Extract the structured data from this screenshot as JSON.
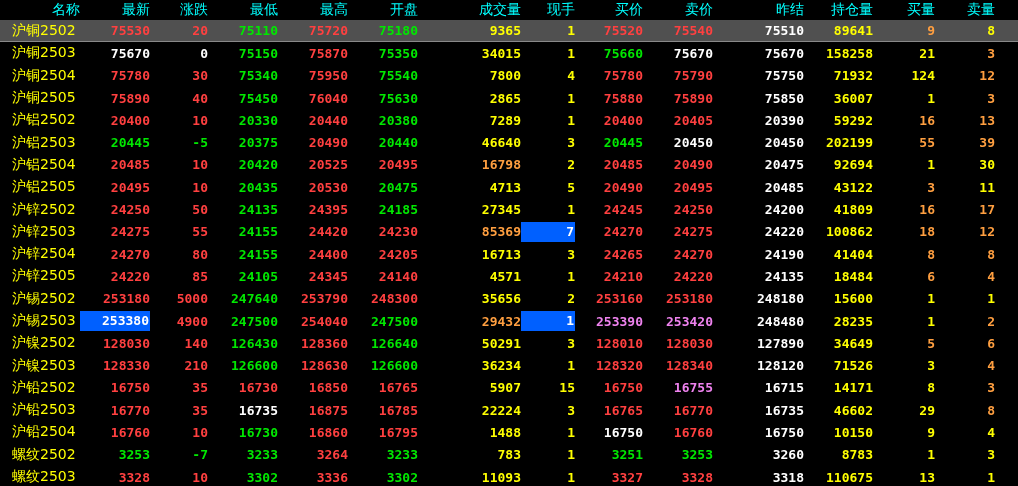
{
  "table": {
    "columns": [
      "名称",
      "最新",
      "涨跌",
      "最低",
      "最高",
      "开盘",
      "成交量",
      "现手",
      "买价",
      "卖价",
      "昨结",
      "持仓量",
      "买量",
      "卖量"
    ],
    "rows": [
      {
        "selected": true,
        "cells": [
          {
            "text": "沪铜2502",
            "color": "#ffff00",
            "highlighted": false
          },
          {
            "text": "75530",
            "color": "#ff4040",
            "highlighted": false
          },
          {
            "text": "20",
            "color": "#ff4040",
            "highlighted": false
          },
          {
            "text": "75110",
            "color": "#00e800",
            "highlighted": false
          },
          {
            "text": "75720",
            "color": "#ff4040",
            "highlighted": false
          },
          {
            "text": "75180",
            "color": "#00e800",
            "highlighted": false
          },
          {
            "text": "9365",
            "color": "#ffff00",
            "highlighted": false
          },
          {
            "text": "1",
            "color": "#ffff00",
            "highlighted": false
          },
          {
            "text": "75520",
            "color": "#ff4040",
            "highlighted": false
          },
          {
            "text": "75540",
            "color": "#ff4040",
            "highlighted": false
          },
          {
            "text": "75510",
            "color": "#ffffff",
            "highlighted": false
          },
          {
            "text": "89641",
            "color": "#ffff00",
            "highlighted": false
          },
          {
            "text": "9",
            "color": "#ff9f40",
            "highlighted": false
          },
          {
            "text": "8",
            "color": "#ffff00",
            "highlighted": false
          }
        ]
      },
      {
        "selected": false,
        "cells": [
          {
            "text": "沪铜2503",
            "color": "#ffff00",
            "highlighted": false
          },
          {
            "text": "75670",
            "color": "#ffffff",
            "highlighted": false
          },
          {
            "text": "0",
            "color": "#ffffff",
            "highlighted": false
          },
          {
            "text": "75150",
            "color": "#00e800",
            "highlighted": false
          },
          {
            "text": "75870",
            "color": "#ff4040",
            "highlighted": false
          },
          {
            "text": "75350",
            "color": "#00e800",
            "highlighted": false
          },
          {
            "text": "34015",
            "color": "#ffff00",
            "highlighted": false
          },
          {
            "text": "1",
            "color": "#ffff00",
            "highlighted": false
          },
          {
            "text": "75660",
            "color": "#00e800",
            "highlighted": false
          },
          {
            "text": "75670",
            "color": "#ffffff",
            "highlighted": false
          },
          {
            "text": "75670",
            "color": "#ffffff",
            "highlighted": false
          },
          {
            "text": "158258",
            "color": "#ffff00",
            "highlighted": false
          },
          {
            "text": "21",
            "color": "#ffff00",
            "highlighted": false
          },
          {
            "text": "3",
            "color": "#ff9f40",
            "highlighted": false
          }
        ]
      },
      {
        "selected": false,
        "cells": [
          {
            "text": "沪铜2504",
            "color": "#ffff00",
            "highlighted": false
          },
          {
            "text": "75780",
            "color": "#ff4040",
            "highlighted": false
          },
          {
            "text": "30",
            "color": "#ff4040",
            "highlighted": false
          },
          {
            "text": "75340",
            "color": "#00e800",
            "highlighted": false
          },
          {
            "text": "75950",
            "color": "#ff4040",
            "highlighted": false
          },
          {
            "text": "75540",
            "color": "#00e800",
            "highlighted": false
          },
          {
            "text": "7800",
            "color": "#ffff00",
            "highlighted": false
          },
          {
            "text": "4",
            "color": "#ffff00",
            "highlighted": false
          },
          {
            "text": "75780",
            "color": "#ff4040",
            "highlighted": false
          },
          {
            "text": "75790",
            "color": "#ff4040",
            "highlighted": false
          },
          {
            "text": "75750",
            "color": "#ffffff",
            "highlighted": false
          },
          {
            "text": "71932",
            "color": "#ffff00",
            "highlighted": false
          },
          {
            "text": "124",
            "color": "#ffff00",
            "highlighted": false
          },
          {
            "text": "12",
            "color": "#ff9f40",
            "highlighted": false
          }
        ]
      },
      {
        "selected": false,
        "cells": [
          {
            "text": "沪铜2505",
            "color": "#ffff00",
            "highlighted": false
          },
          {
            "text": "75890",
            "color": "#ff4040",
            "highlighted": false
          },
          {
            "text": "40",
            "color": "#ff4040",
            "highlighted": false
          },
          {
            "text": "75450",
            "color": "#00e800",
            "highlighted": false
          },
          {
            "text": "76040",
            "color": "#ff4040",
            "highlighted": false
          },
          {
            "text": "75630",
            "color": "#00e800",
            "highlighted": false
          },
          {
            "text": "2865",
            "color": "#ffff00",
            "highlighted": false
          },
          {
            "text": "1",
            "color": "#ffff00",
            "highlighted": false
          },
          {
            "text": "75880",
            "color": "#ff4040",
            "highlighted": false
          },
          {
            "text": "75890",
            "color": "#ff4040",
            "highlighted": false
          },
          {
            "text": "75850",
            "color": "#ffffff",
            "highlighted": false
          },
          {
            "text": "36007",
            "color": "#ffff00",
            "highlighted": false
          },
          {
            "text": "1",
            "color": "#ffff00",
            "highlighted": false
          },
          {
            "text": "3",
            "color": "#ff9f40",
            "highlighted": false
          }
        ]
      },
      {
        "selected": false,
        "cells": [
          {
            "text": "沪铝2502",
            "color": "#ffff00",
            "highlighted": false
          },
          {
            "text": "20400",
            "color": "#ff4040",
            "highlighted": false
          },
          {
            "text": "10",
            "color": "#ff4040",
            "highlighted": false
          },
          {
            "text": "20330",
            "color": "#00e800",
            "highlighted": false
          },
          {
            "text": "20440",
            "color": "#ff4040",
            "highlighted": false
          },
          {
            "text": "20380",
            "color": "#00e800",
            "highlighted": false
          },
          {
            "text": "7289",
            "color": "#ffff00",
            "highlighted": false
          },
          {
            "text": "1",
            "color": "#ffff00",
            "highlighted": false
          },
          {
            "text": "20400",
            "color": "#ff4040",
            "highlighted": false
          },
          {
            "text": "20405",
            "color": "#ff4040",
            "highlighted": false
          },
          {
            "text": "20390",
            "color": "#ffffff",
            "highlighted": false
          },
          {
            "text": "59292",
            "color": "#ffff00",
            "highlighted": false
          },
          {
            "text": "16",
            "color": "#ff9f40",
            "highlighted": false
          },
          {
            "text": "13",
            "color": "#ff9f40",
            "highlighted": false
          }
        ]
      },
      {
        "selected": false,
        "cells": [
          {
            "text": "沪铝2503",
            "color": "#ffff00",
            "highlighted": false
          },
          {
            "text": "20445",
            "color": "#00e800",
            "highlighted": false
          },
          {
            "text": "-5",
            "color": "#00e800",
            "highlighted": false
          },
          {
            "text": "20375",
            "color": "#00e800",
            "highlighted": false
          },
          {
            "text": "20490",
            "color": "#ff4040",
            "highlighted": false
          },
          {
            "text": "20440",
            "color": "#00e800",
            "highlighted": false
          },
          {
            "text": "46640",
            "color": "#ffff00",
            "highlighted": false
          },
          {
            "text": "3",
            "color": "#ffff00",
            "highlighted": false
          },
          {
            "text": "20445",
            "color": "#00e800",
            "highlighted": false
          },
          {
            "text": "20450",
            "color": "#ffffff",
            "highlighted": false
          },
          {
            "text": "20450",
            "color": "#ffffff",
            "highlighted": false
          },
          {
            "text": "202199",
            "color": "#ffff00",
            "highlighted": false
          },
          {
            "text": "55",
            "color": "#ff9f40",
            "highlighted": false
          },
          {
            "text": "39",
            "color": "#ff9f40",
            "highlighted": false
          }
        ]
      },
      {
        "selected": false,
        "cells": [
          {
            "text": "沪铝2504",
            "color": "#ffff00",
            "highlighted": false
          },
          {
            "text": "20485",
            "color": "#ff4040",
            "highlighted": false
          },
          {
            "text": "10",
            "color": "#ff4040",
            "highlighted": false
          },
          {
            "text": "20420",
            "color": "#00e800",
            "highlighted": false
          },
          {
            "text": "20525",
            "color": "#ff4040",
            "highlighted": false
          },
          {
            "text": "20495",
            "color": "#ff4040",
            "highlighted": false
          },
          {
            "text": "16798",
            "color": "#ff9f40",
            "highlighted": false
          },
          {
            "text": "2",
            "color": "#ffff00",
            "highlighted": false
          },
          {
            "text": "20485",
            "color": "#ff4040",
            "highlighted": false
          },
          {
            "text": "20490",
            "color": "#ff4040",
            "highlighted": false
          },
          {
            "text": "20475",
            "color": "#ffffff",
            "highlighted": false
          },
          {
            "text": "92694",
            "color": "#ffff00",
            "highlighted": false
          },
          {
            "text": "1",
            "color": "#ffff00",
            "highlighted": false
          },
          {
            "text": "30",
            "color": "#ffff00",
            "highlighted": false
          }
        ]
      },
      {
        "selected": false,
        "cells": [
          {
            "text": "沪铝2505",
            "color": "#ffff00",
            "highlighted": false
          },
          {
            "text": "20495",
            "color": "#ff4040",
            "highlighted": false
          },
          {
            "text": "10",
            "color": "#ff4040",
            "highlighted": false
          },
          {
            "text": "20435",
            "color": "#00e800",
            "highlighted": false
          },
          {
            "text": "20530",
            "color": "#ff4040",
            "highlighted": false
          },
          {
            "text": "20475",
            "color": "#00e800",
            "highlighted": false
          },
          {
            "text": "4713",
            "color": "#ffff00",
            "highlighted": false
          },
          {
            "text": "5",
            "color": "#ffff00",
            "highlighted": false
          },
          {
            "text": "20490",
            "color": "#ff4040",
            "highlighted": false
          },
          {
            "text": "20495",
            "color": "#ff4040",
            "highlighted": false
          },
          {
            "text": "20485",
            "color": "#ffffff",
            "highlighted": false
          },
          {
            "text": "43122",
            "color": "#ffff00",
            "highlighted": false
          },
          {
            "text": "3",
            "color": "#ff9f40",
            "highlighted": false
          },
          {
            "text": "11",
            "color": "#ffff00",
            "highlighted": false
          }
        ]
      },
      {
        "selected": false,
        "cells": [
          {
            "text": "沪锌2502",
            "color": "#ffff00",
            "highlighted": false
          },
          {
            "text": "24250",
            "color": "#ff4040",
            "highlighted": false
          },
          {
            "text": "50",
            "color": "#ff4040",
            "highlighted": false
          },
          {
            "text": "24135",
            "color": "#00e800",
            "highlighted": false
          },
          {
            "text": "24395",
            "color": "#ff4040",
            "highlighted": false
          },
          {
            "text": "24185",
            "color": "#00e800",
            "highlighted": false
          },
          {
            "text": "27345",
            "color": "#ffff00",
            "highlighted": false
          },
          {
            "text": "1",
            "color": "#ffff00",
            "highlighted": false
          },
          {
            "text": "24245",
            "color": "#ff4040",
            "highlighted": false
          },
          {
            "text": "24250",
            "color": "#ff4040",
            "highlighted": false
          },
          {
            "text": "24200",
            "color": "#ffffff",
            "highlighted": false
          },
          {
            "text": "41809",
            "color": "#ffff00",
            "highlighted": false
          },
          {
            "text": "16",
            "color": "#ff9f40",
            "highlighted": false
          },
          {
            "text": "17",
            "color": "#ff9f40",
            "highlighted": false
          }
        ]
      },
      {
        "selected": false,
        "cells": [
          {
            "text": "沪锌2503",
            "color": "#ffff00",
            "highlighted": false
          },
          {
            "text": "24275",
            "color": "#ff4040",
            "highlighted": false
          },
          {
            "text": "55",
            "color": "#ff4040",
            "highlighted": false
          },
          {
            "text": "24155",
            "color": "#00e800",
            "highlighted": false
          },
          {
            "text": "24420",
            "color": "#ff4040",
            "highlighted": false
          },
          {
            "text": "24230",
            "color": "#ff4040",
            "highlighted": false
          },
          {
            "text": "85369",
            "color": "#ff9f40",
            "highlighted": false
          },
          {
            "text": "7",
            "highlighted": true
          },
          {
            "text": "24270",
            "color": "#ff4040",
            "highlighted": false
          },
          {
            "text": "24275",
            "color": "#ff4040",
            "highlighted": false
          },
          {
            "text": "24220",
            "color": "#ffffff",
            "highlighted": false
          },
          {
            "text": "100862",
            "color": "#ffff00",
            "highlighted": false
          },
          {
            "text": "18",
            "color": "#ff9f40",
            "highlighted": false
          },
          {
            "text": "12",
            "color": "#ff9f40",
            "highlighted": false
          }
        ]
      },
      {
        "selected": false,
        "cells": [
          {
            "text": "沪锌2504",
            "color": "#ffff00",
            "highlighted": false
          },
          {
            "text": "24270",
            "color": "#ff4040",
            "highlighted": false
          },
          {
            "text": "80",
            "color": "#ff4040",
            "highlighted": false
          },
          {
            "text": "24155",
            "color": "#00e800",
            "highlighted": false
          },
          {
            "text": "24400",
            "color": "#ff4040",
            "highlighted": false
          },
          {
            "text": "24205",
            "color": "#ff4040",
            "highlighted": false
          },
          {
            "text": "16713",
            "color": "#ffff00",
            "highlighted": false
          },
          {
            "text": "3",
            "color": "#ffff00",
            "highlighted": false
          },
          {
            "text": "24265",
            "color": "#ff4040",
            "highlighted": false
          },
          {
            "text": "24270",
            "color": "#ff4040",
            "highlighted": false
          },
          {
            "text": "24190",
            "color": "#ffffff",
            "highlighted": false
          },
          {
            "text": "41404",
            "color": "#ffff00",
            "highlighted": false
          },
          {
            "text": "8",
            "color": "#ff9f40",
            "highlighted": false
          },
          {
            "text": "8",
            "color": "#ff9f40",
            "highlighted": false
          }
        ]
      },
      {
        "selected": false,
        "cells": [
          {
            "text": "沪锌2505",
            "color": "#ffff00",
            "highlighted": false
          },
          {
            "text": "24220",
            "color": "#ff4040",
            "highlighted": false
          },
          {
            "text": "85",
            "color": "#ff4040",
            "highlighted": false
          },
          {
            "text": "24105",
            "color": "#00e800",
            "highlighted": false
          },
          {
            "text": "24345",
            "color": "#ff4040",
            "highlighted": false
          },
          {
            "text": "24140",
            "color": "#ff4040",
            "highlighted": false
          },
          {
            "text": "4571",
            "color": "#ffff00",
            "highlighted": false
          },
          {
            "text": "1",
            "color": "#ffff00",
            "highlighted": false
          },
          {
            "text": "24210",
            "color": "#ff4040",
            "highlighted": false
          },
          {
            "text": "24220",
            "color": "#ff4040",
            "highlighted": false
          },
          {
            "text": "24135",
            "color": "#ffffff",
            "highlighted": false
          },
          {
            "text": "18484",
            "color": "#ffff00",
            "highlighted": false
          },
          {
            "text": "6",
            "color": "#ff9f40",
            "highlighted": false
          },
          {
            "text": "4",
            "color": "#ff9f40",
            "highlighted": false
          }
        ]
      },
      {
        "selected": false,
        "cells": [
          {
            "text": "沪锡2502",
            "color": "#ffff00",
            "highlighted": false
          },
          {
            "text": "253180",
            "color": "#ff4040",
            "highlighted": false
          },
          {
            "text": "5000",
            "color": "#ff4040",
            "highlighted": false
          },
          {
            "text": "247640",
            "color": "#00e800",
            "highlighted": false
          },
          {
            "text": "253790",
            "color": "#ff4040",
            "highlighted": false
          },
          {
            "text": "248300",
            "color": "#ff4040",
            "highlighted": false
          },
          {
            "text": "35656",
            "color": "#ffff00",
            "highlighted": false
          },
          {
            "text": "2",
            "color": "#ffff00",
            "highlighted": false
          },
          {
            "text": "253160",
            "color": "#ff4040",
            "highlighted": false
          },
          {
            "text": "253180",
            "color": "#ff4040",
            "highlighted": false
          },
          {
            "text": "248180",
            "color": "#ffffff",
            "highlighted": false
          },
          {
            "text": "15600",
            "color": "#ffff00",
            "highlighted": false
          },
          {
            "text": "1",
            "color": "#ffff00",
            "highlighted": false
          },
          {
            "text": "1",
            "color": "#ffff00",
            "highlighted": false
          }
        ]
      },
      {
        "selected": false,
        "cells": [
          {
            "text": "沪锡2503",
            "color": "#ffff00",
            "highlighted": false
          },
          {
            "text": "253380",
            "highlighted": true
          },
          {
            "text": "4900",
            "color": "#ff4040",
            "highlighted": false
          },
          {
            "text": "247500",
            "color": "#00e800",
            "highlighted": false
          },
          {
            "text": "254040",
            "color": "#ff4040",
            "highlighted": false
          },
          {
            "text": "247500",
            "color": "#00e800",
            "highlighted": false
          },
          {
            "text": "29432",
            "color": "#ff9f40",
            "highlighted": false
          },
          {
            "text": "1",
            "highlighted": true
          },
          {
            "text": "253390",
            "color": "#ee82ee",
            "highlighted": false
          },
          {
            "text": "253420",
            "color": "#ee82ee",
            "highlighted": false
          },
          {
            "text": "248480",
            "color": "#ffffff",
            "highlighted": false
          },
          {
            "text": "28235",
            "color": "#ffff00",
            "highlighted": false
          },
          {
            "text": "1",
            "color": "#ffff00",
            "highlighted": false
          },
          {
            "text": "2",
            "color": "#ff9f40",
            "highlighted": false
          }
        ]
      },
      {
        "selected": false,
        "cells": [
          {
            "text": "沪镍2502",
            "color": "#ffff00",
            "highlighted": false
          },
          {
            "text": "128030",
            "color": "#ff4040",
            "highlighted": false
          },
          {
            "text": "140",
            "color": "#ff4040",
            "highlighted": false
          },
          {
            "text": "126430",
            "color": "#00e800",
            "highlighted": false
          },
          {
            "text": "128360",
            "color": "#ff4040",
            "highlighted": false
          },
          {
            "text": "126640",
            "color": "#00e800",
            "highlighted": false
          },
          {
            "text": "50291",
            "color": "#ffff00",
            "highlighted": false
          },
          {
            "text": "3",
            "color": "#ffff00",
            "highlighted": false
          },
          {
            "text": "128010",
            "color": "#ff4040",
            "highlighted": false
          },
          {
            "text": "128030",
            "color": "#ff4040",
            "highlighted": false
          },
          {
            "text": "127890",
            "color": "#ffffff",
            "highlighted": false
          },
          {
            "text": "34649",
            "color": "#ffff00",
            "highlighted": false
          },
          {
            "text": "5",
            "color": "#ff9f40",
            "highlighted": false
          },
          {
            "text": "6",
            "color": "#ff9f40",
            "highlighted": false
          }
        ]
      },
      {
        "selected": false,
        "cells": [
          {
            "text": "沪镍2503",
            "color": "#ffff00",
            "highlighted": false
          },
          {
            "text": "128330",
            "color": "#ff4040",
            "highlighted": false
          },
          {
            "text": "210",
            "color": "#ff4040",
            "highlighted": false
          },
          {
            "text": "126600",
            "color": "#00e800",
            "highlighted": false
          },
          {
            "text": "128630",
            "color": "#ff4040",
            "highlighted": false
          },
          {
            "text": "126600",
            "color": "#00e800",
            "highlighted": false
          },
          {
            "text": "36234",
            "color": "#ffff00",
            "highlighted": false
          },
          {
            "text": "1",
            "color": "#ffff00",
            "highlighted": false
          },
          {
            "text": "128320",
            "color": "#ff4040",
            "highlighted": false
          },
          {
            "text": "128340",
            "color": "#ff4040",
            "highlighted": false
          },
          {
            "text": "128120",
            "color": "#ffffff",
            "highlighted": false
          },
          {
            "text": "71526",
            "color": "#ffff00",
            "highlighted": false
          },
          {
            "text": "3",
            "color": "#ffff00",
            "highlighted": false
          },
          {
            "text": "4",
            "color": "#ff9f40",
            "highlighted": false
          }
        ]
      },
      {
        "selected": false,
        "cells": [
          {
            "text": "沪铅2502",
            "color": "#ffff00",
            "highlighted": false
          },
          {
            "text": "16750",
            "color": "#ff4040",
            "highlighted": false
          },
          {
            "text": "35",
            "color": "#ff4040",
            "highlighted": false
          },
          {
            "text": "16730",
            "color": "#ff4040",
            "highlighted": false
          },
          {
            "text": "16850",
            "color": "#ff4040",
            "highlighted": false
          },
          {
            "text": "16765",
            "color": "#ff4040",
            "highlighted": false
          },
          {
            "text": "5907",
            "color": "#ffff00",
            "highlighted": false
          },
          {
            "text": "15",
            "color": "#ffff00",
            "highlighted": false
          },
          {
            "text": "16750",
            "color": "#ff4040",
            "highlighted": false
          },
          {
            "text": "16755",
            "color": "#ee82ee",
            "highlighted": false
          },
          {
            "text": "16715",
            "color": "#ffffff",
            "highlighted": false
          },
          {
            "text": "14171",
            "color": "#ffff00",
            "highlighted": false
          },
          {
            "text": "8",
            "color": "#ffff00",
            "highlighted": false
          },
          {
            "text": "3",
            "color": "#ff9f40",
            "highlighted": false
          }
        ]
      },
      {
        "selected": false,
        "cells": [
          {
            "text": "沪铅2503",
            "color": "#ffff00",
            "highlighted": false
          },
          {
            "text": "16770",
            "color": "#ff4040",
            "highlighted": false
          },
          {
            "text": "35",
            "color": "#ff4040",
            "highlighted": false
          },
          {
            "text": "16735",
            "color": "#ffffff",
            "highlighted": false
          },
          {
            "text": "16875",
            "color": "#ff4040",
            "highlighted": false
          },
          {
            "text": "16785",
            "color": "#ff4040",
            "highlighted": false
          },
          {
            "text": "22224",
            "color": "#ffff00",
            "highlighted": false
          },
          {
            "text": "3",
            "color": "#ffff00",
            "highlighted": false
          },
          {
            "text": "16765",
            "color": "#ff4040",
            "highlighted": false
          },
          {
            "text": "16770",
            "color": "#ff4040",
            "highlighted": false
          },
          {
            "text": "16735",
            "color": "#ffffff",
            "highlighted": false
          },
          {
            "text": "46602",
            "color": "#ffff00",
            "highlighted": false
          },
          {
            "text": "29",
            "color": "#ffff00",
            "highlighted": false
          },
          {
            "text": "8",
            "color": "#ff9f40",
            "highlighted": false
          }
        ]
      },
      {
        "selected": false,
        "cells": [
          {
            "text": "沪铅2504",
            "color": "#ffff00",
            "highlighted": false
          },
          {
            "text": "16760",
            "color": "#ff4040",
            "highlighted": false
          },
          {
            "text": "10",
            "color": "#ff4040",
            "highlighted": false
          },
          {
            "text": "16730",
            "color": "#00e800",
            "highlighted": false
          },
          {
            "text": "16860",
            "color": "#ff4040",
            "highlighted": false
          },
          {
            "text": "16795",
            "color": "#ff4040",
            "highlighted": false
          },
          {
            "text": "1488",
            "color": "#ffff00",
            "highlighted": false
          },
          {
            "text": "1",
            "color": "#ffff00",
            "highlighted": false
          },
          {
            "text": "16750",
            "color": "#ffffff",
            "highlighted": false
          },
          {
            "text": "16760",
            "color": "#ff4040",
            "highlighted": false
          },
          {
            "text": "16750",
            "color": "#ffffff",
            "highlighted": false
          },
          {
            "text": "10150",
            "color": "#ffff00",
            "highlighted": false
          },
          {
            "text": "9",
            "color": "#ffff00",
            "highlighted": false
          },
          {
            "text": "4",
            "color": "#ffff00",
            "highlighted": false
          }
        ]
      },
      {
        "selected": false,
        "cells": [
          {
            "text": "螺纹2502",
            "color": "#ffff00",
            "highlighted": false
          },
          {
            "text": "3253",
            "color": "#00e800",
            "highlighted": false
          },
          {
            "text": "-7",
            "color": "#00e800",
            "highlighted": false
          },
          {
            "text": "3233",
            "color": "#00e800",
            "highlighted": false
          },
          {
            "text": "3264",
            "color": "#ff4040",
            "highlighted": false
          },
          {
            "text": "3233",
            "color": "#00e800",
            "highlighted": false
          },
          {
            "text": "783",
            "color": "#ffff00",
            "highlighted": false
          },
          {
            "text": "1",
            "color": "#ffff00",
            "highlighted": false
          },
          {
            "text": "3251",
            "color": "#00e800",
            "highlighted": false
          },
          {
            "text": "3253",
            "color": "#00e800",
            "highlighted": false
          },
          {
            "text": "3260",
            "color": "#ffffff",
            "highlighted": false
          },
          {
            "text": "8783",
            "color": "#ffff00",
            "highlighted": false
          },
          {
            "text": "1",
            "color": "#ffff00",
            "highlighted": false
          },
          {
            "text": "3",
            "color": "#ffff00",
            "highlighted": false
          }
        ]
      },
      {
        "selected": false,
        "cells": [
          {
            "text": "螺纹2503",
            "color": "#ffff00",
            "highlighted": false
          },
          {
            "text": "3328",
            "color": "#ff4040",
            "highlighted": false
          },
          {
            "text": "10",
            "color": "#ff4040",
            "highlighted": false
          },
          {
            "text": "3302",
            "color": "#00e800",
            "highlighted": false
          },
          {
            "text": "3336",
            "color": "#ff4040",
            "highlighted": false
          },
          {
            "text": "3302",
            "color": "#00e800",
            "highlighted": false
          },
          {
            "text": "11093",
            "color": "#ffff00",
            "highlighted": false
          },
          {
            "text": "1",
            "color": "#ffff00",
            "highlighted": false
          },
          {
            "text": "3327",
            "color": "#ff4040",
            "highlighted": false
          },
          {
            "text": "3328",
            "color": "#ff4040",
            "highlighted": false
          },
          {
            "text": "3318",
            "color": "#ffffff",
            "highlighted": false
          },
          {
            "text": "110675",
            "color": "#ffff00",
            "highlighted": false
          },
          {
            "text": "13",
            "color": "#ffff00",
            "highlighted": false
          },
          {
            "text": "1",
            "color": "#ffff00",
            "highlighted": false
          }
        ]
      }
    ]
  }
}
